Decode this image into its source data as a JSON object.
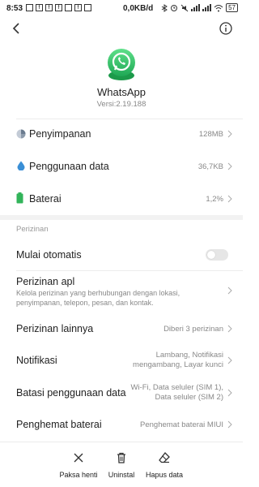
{
  "status_bar": {
    "time": "8:53",
    "network_speed": "0,0KB/d",
    "battery": "57"
  },
  "app": {
    "name": "WhatsApp",
    "version": "Versi:2.19.188",
    "accent": "#25D366"
  },
  "storage_rows": [
    {
      "label": "Penyimpanan",
      "value": "128MB",
      "icon": "storage-pie-icon",
      "color": "#6b7c8f"
    },
    {
      "label": "Penggunaan data",
      "value": "36,7KB",
      "icon": "water-drop-icon",
      "color": "#3a8fd6"
    },
    {
      "label": "Baterai",
      "value": "1,2%",
      "icon": "battery-icon",
      "color": "#32b45a"
    }
  ],
  "permissions": {
    "section_title": "Perizinan",
    "auto_start_label": "Mulai otomatis",
    "app_permissions_label": "Perizinan apl",
    "app_permissions_desc": "Kelola perizinan yang berhubungan dengan lokasi, penyimpanan, telepon, pesan, dan kontak.",
    "other_permissions_label": "Perizinan lainnya",
    "other_permissions_value": "Diberi 3 perizinan",
    "notifications_label": "Notifikasi",
    "notifications_value_1": "Lambang, Notifikasi",
    "notifications_value_2": "mengambang, Layar kunci",
    "data_limit_label": "Batasi penggunaan data",
    "data_limit_value_1": "Wi-Fi, Data seluler (SIM 1),",
    "data_limit_value_2": "Data seluler (SIM 2)",
    "battery_saver_label": "Penghemat baterai",
    "battery_saver_value": "Penghemat baterai MIUI"
  },
  "bottom_actions": [
    {
      "label": "Paksa henti",
      "icon": "close-x-icon"
    },
    {
      "label": "Uninstal",
      "icon": "trash-icon"
    },
    {
      "label": "Hapus data",
      "icon": "eraser-icon"
    }
  ]
}
